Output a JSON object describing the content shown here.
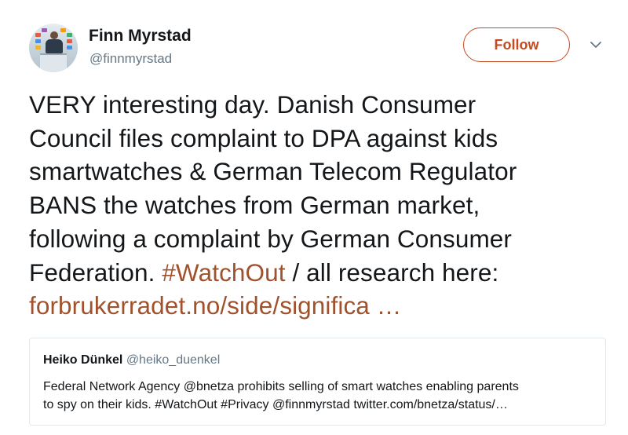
{
  "author": {
    "name": "Finn Myrstad",
    "handle": "@finnmyrstad"
  },
  "follow_button": {
    "label": "Follow"
  },
  "tweet": {
    "lines": [
      "VERY interesting day. Danish Consumer",
      "Council files complaint to DPA against kids",
      "smartwatches & German Telecom Regulator",
      "BANS the watches from German market,",
      "following a complaint by German Consumer"
    ],
    "line6_pre": "Federation. ",
    "hashtag": "#WatchOut",
    "line6_post": " / all research here:",
    "url": "forbrukerradet.no/side/significa …"
  },
  "quoted_tweet": {
    "name": "Heiko Dünkel",
    "handle": "@heiko_duenkel",
    "lines": [
      "Federal Network Agency @bnetza prohibits selling of smart watches enabling parents",
      "to spy on their kids. #WatchOut #Privacy @finnmyrstad twitter.com/bnetza/status/…"
    ]
  },
  "colors": {
    "accent": "#c54b1f",
    "link": "#a0522d",
    "text": "#14171a",
    "secondary": "#657786",
    "border": "#e1e8ed"
  },
  "icons": {
    "more": "chevron-down-icon"
  }
}
